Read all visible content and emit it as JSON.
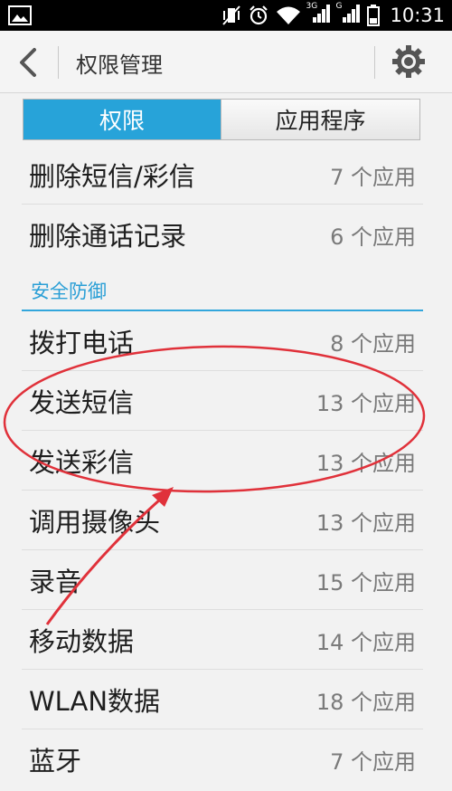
{
  "status_bar": {
    "time": "10:31",
    "net1": "3G",
    "net2": "G"
  },
  "action_bar": {
    "title": "权限管理"
  },
  "tabs": [
    {
      "label": "权限",
      "selected": true
    },
    {
      "label": "应用程序",
      "selected": false
    }
  ],
  "list_top": [
    {
      "name": "删除短信/彩信",
      "count": "7 个应用"
    },
    {
      "name": "删除通话记录",
      "count": "6 个应用"
    }
  ],
  "section_title": "安全防御",
  "list_main": [
    {
      "name": "拨打电话",
      "count": "8 个应用"
    },
    {
      "name": "发送短信",
      "count": "13 个应用"
    },
    {
      "name": "发送彩信",
      "count": "13 个应用"
    },
    {
      "name": "调用摄像头",
      "count": "13 个应用"
    },
    {
      "name": "录音",
      "count": "15 个应用"
    },
    {
      "name": "移动数据",
      "count": "14 个应用"
    },
    {
      "name": "WLAN数据",
      "count": "18 个应用"
    },
    {
      "name": "蓝牙",
      "count": "7 个应用"
    }
  ],
  "colors": {
    "accent": "#27a3d9",
    "annotation": "#e0313a"
  }
}
